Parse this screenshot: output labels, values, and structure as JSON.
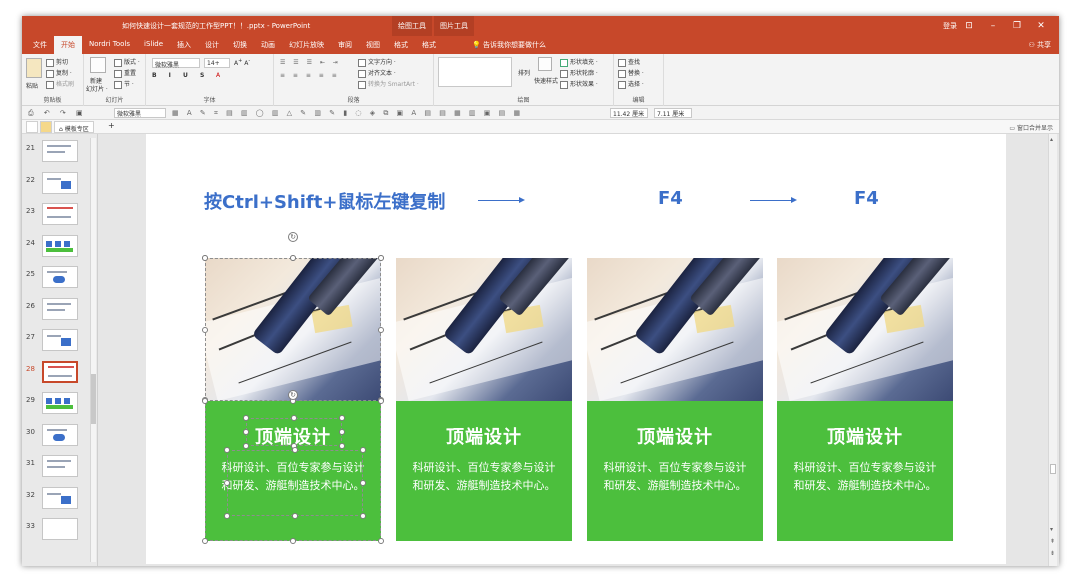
{
  "window": {
    "title": "如何快速设计一套规范的工作型PPT！！.pptx  -  PowerPoint",
    "context_tabs": [
      "绘图工具",
      "图片工具"
    ],
    "login": "登录",
    "controls": [
      "⊡",
      "–",
      "❐",
      "✕"
    ]
  },
  "menu": {
    "tabs": [
      "文件",
      "开始",
      "Nordri Tools",
      "iSlide",
      "插入",
      "设计",
      "切换",
      "动画",
      "幻灯片放映",
      "审阅",
      "视图",
      "格式",
      "格式"
    ],
    "active_index": 1,
    "tell_me": "告诉我你想要做什么",
    "share": "共享"
  },
  "ribbon": {
    "clipboard": {
      "paste": "粘贴",
      "cut": "剪切",
      "copy": "复制 ·",
      "format_painter": "格式刷",
      "name": "剪贴板"
    },
    "slides": {
      "new_slide": "新建",
      "new_slide2": "幻灯片 ·",
      "layout": "版式 ·",
      "reset": "重置",
      "section": "节 ·",
      "name": "幻灯片"
    },
    "font": {
      "font_name": "微软雅黑",
      "font_size": "14+",
      "name": "字体"
    },
    "paragraph": {
      "text_direction": "文字方向 ·",
      "align_text": "对齐文本 ·",
      "smartart": "转换为 SmartArt ·",
      "name": "段落"
    },
    "drawing": {
      "arrange": "排列",
      "quick_styles": "快速样式",
      "shape_fill": "形状填充 ·",
      "shape_outline": "形状轮廓 ·",
      "shape_effects": "形状效果 ·",
      "name": "绘图"
    },
    "editing": {
      "find": "查找",
      "replace": "替换 ·",
      "select": "选择 ·",
      "name": "编辑"
    }
  },
  "qat": {
    "font": "微软雅黑",
    "width": "11.42 厘米",
    "height": "7.11 厘米"
  },
  "doctabs": {
    "tab": "模板专区",
    "plus": "+",
    "merge": "窗口合并显示"
  },
  "thumbnails": {
    "numbers": [
      "21",
      "22",
      "23",
      "24",
      "25",
      "26",
      "27",
      "28",
      "29",
      "30",
      "31",
      "32",
      "33"
    ],
    "current": "28"
  },
  "slide": {
    "caption1": "按Ctrl+Shift+鼠标左键复制",
    "caption2": "F4",
    "caption3": "F4",
    "cards": [
      {
        "title": "顶端设计",
        "body": "科研设计、百位专家参与设计和研发、游艇制造技术中心。"
      },
      {
        "title": "顶端设计",
        "body": "科研设计、百位专家参与设计和研发、游艇制造技术中心。"
      },
      {
        "title": "顶端设计",
        "body": "科研设计、百位专家参与设计和研发、游艇制造技术中心。"
      },
      {
        "title": "顶端设计",
        "body": "科研设计、百位专家参与设计和研发、游艇制造技术中心。"
      }
    ]
  },
  "colors": {
    "accent": "#c7482a",
    "caption_blue": "#3b6fc9",
    "card_green": "#4cbf3d"
  }
}
